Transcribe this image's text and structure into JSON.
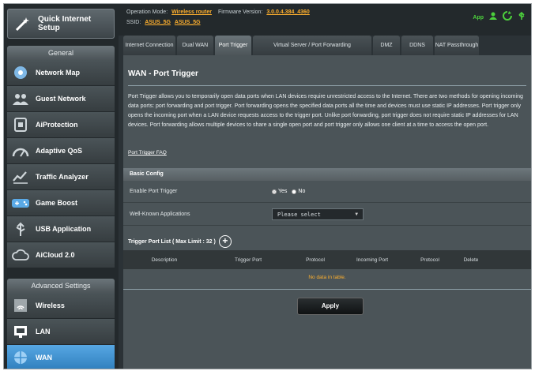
{
  "sidebar": {
    "quick_setup": "Quick Internet Setup",
    "general_header": "General",
    "general_items": [
      {
        "label": "Network Map",
        "icon": "network-map-icon"
      },
      {
        "label": "Guest Network",
        "icon": "guest-network-icon"
      },
      {
        "label": "AiProtection",
        "icon": "aiprotection-icon"
      },
      {
        "label": "Adaptive QoS",
        "icon": "adaptive-qos-icon"
      },
      {
        "label": "Traffic Analyzer",
        "icon": "traffic-analyzer-icon"
      },
      {
        "label": "Game Boost",
        "icon": "game-boost-icon"
      },
      {
        "label": "USB Application",
        "icon": "usb-application-icon"
      },
      {
        "label": "AiCloud 2.0",
        "icon": "aicloud-icon"
      }
    ],
    "advanced_header": "Advanced Settings",
    "advanced_items": [
      {
        "label": "Wireless",
        "icon": "wireless-icon",
        "active": false
      },
      {
        "label": "LAN",
        "icon": "lan-icon",
        "active": false
      },
      {
        "label": "WAN",
        "icon": "wan-icon",
        "active": true
      }
    ]
  },
  "topbar": {
    "opmode_label": "Operation Mode:",
    "opmode_value": "Wireless router",
    "firmware_label": "Firmware Version:",
    "firmware_value": "3.0.0.4.384_4360",
    "ssid_label": "SSID:",
    "ssid_1": "ASUS_5G",
    "ssid_2": "ASUS_5G",
    "app_label": "App"
  },
  "tabs": [
    {
      "label": "Internet Connection",
      "active": false
    },
    {
      "label": "Dual WAN",
      "active": false
    },
    {
      "label": "Port Trigger",
      "active": true
    },
    {
      "label": "Virtual Server / Port Forwarding",
      "active": false
    },
    {
      "label": "DMZ",
      "active": false
    },
    {
      "label": "DDNS",
      "active": false
    },
    {
      "label": "NAT Passthrough",
      "active": false
    }
  ],
  "content": {
    "title": "WAN - Port Trigger",
    "description": "Port Trigger allows you to temporarily open data ports when LAN devices require unrestricted access to the Internet. There are two methods for opening incoming data ports: port forwarding and port trigger. Port forwarding opens the specified data ports all the time and devices must use static IP addresses. Port trigger only opens the incoming port when a LAN device requests access to the trigger port. Unlike port forwarding, port trigger does not require static IP addresses for LAN devices. Port forwarding allows multiple devices to share a single open port and port trigger only allows one client at a time to access the open port.",
    "faq_link": "Port Trigger FAQ",
    "basic_config_header": "Basic Config",
    "enable_label": "Enable Port Trigger",
    "yes_label": "Yes",
    "no_label": "No",
    "enable_value": "Yes",
    "apps_label": "Well-Known Applications",
    "apps_value": "Please select",
    "trigger_list_title": "Trigger Port List ( Max Limit : 32 )",
    "table_headers": [
      "Description",
      "Trigger Port",
      "Protocol",
      "Incoming Port",
      "Protocol",
      "Delete"
    ],
    "no_data": "No data in table.",
    "apply_label": "Apply"
  },
  "colors": {
    "accent_orange": "#ffb02e",
    "active_nav_blue": "#3d8fd0",
    "app_green": "#4cd13c"
  }
}
